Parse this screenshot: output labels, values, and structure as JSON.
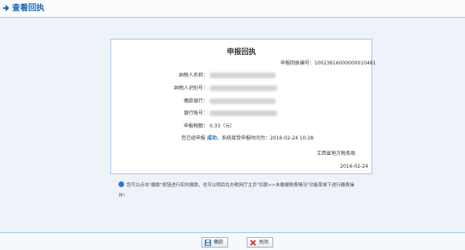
{
  "header": {
    "title": "查看回执"
  },
  "receipt": {
    "title": "申报回执",
    "serial_label": "申报回执编号：",
    "serial_value": "10023616000000010481",
    "taxpayer_name_label": "纳税人名称：",
    "taxpayer_id_label": "纳税人识别号：",
    "bank_label": "缴款银行：",
    "account_label": "银行账号：",
    "amount_label": "申报税额：",
    "amount_value": "0.33（元）",
    "status_prefix": "您已经申报",
    "status_success": "成功",
    "status_suffix": "，系统接受申报时间为：",
    "status_time": "2016-02-24 10:28",
    "issuer": "江西省地方税务局",
    "issue_date": "2016-02-24"
  },
  "note": {
    "text": "您可以点击\"缴款\"按钮进行实时缴款，也可以稍后在办税网厅主页\"扣款>>未缴缴税费情况\"功能菜单下进行缴费操作！"
  },
  "buttons": {
    "pay": "缴款",
    "close": "关闭"
  },
  "colors": {
    "accent": "#1f63b3",
    "border": "#a9c3e3",
    "background": "#eef3f9"
  }
}
